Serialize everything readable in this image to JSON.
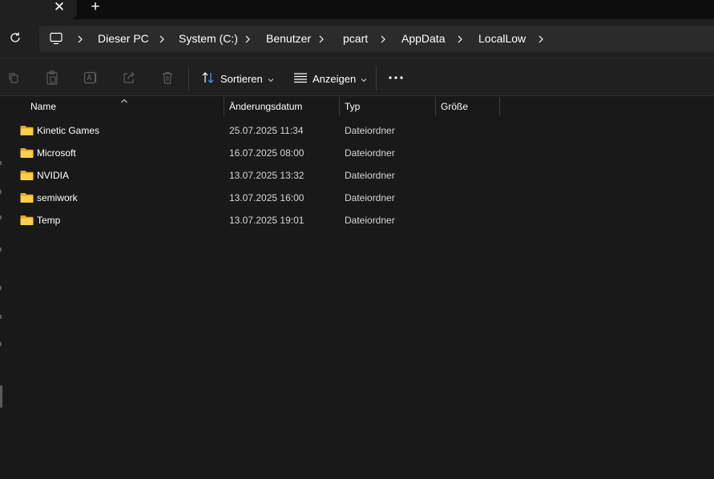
{
  "tabstrip": {
    "close_glyph": "✕",
    "new_tab_glyph": "+"
  },
  "address": {
    "refresh_icon": "refresh-icon",
    "computer_icon": "computer-icon",
    "separator_icon": "chevron-right-icon",
    "crumbs": [
      "Dieser PC",
      "System (C:)",
      "Benutzer",
      "pcart",
      "AppData",
      "LocalLow"
    ]
  },
  "commandbar": {
    "icons": [
      "copy-icon",
      "paste-icon",
      "rename-icon",
      "share-icon",
      "delete-icon"
    ],
    "sort_label": "Sortieren",
    "view_label": "Anzeigen",
    "more_icon": "more-icon"
  },
  "columns": {
    "name": "Name",
    "date": "Änderungsdatum",
    "type": "Typ",
    "size": "Größe"
  },
  "files": [
    {
      "name": "Kinetic Games",
      "date": "25.07.2025 11:34",
      "type": "Dateiordner"
    },
    {
      "name": "Microsoft",
      "date": "16.07.2025 08:00",
      "type": "Dateiordner"
    },
    {
      "name": "NVIDIA",
      "date": "13.07.2025 13:32",
      "type": "Dateiordner"
    },
    {
      "name": "semiwork",
      "date": "13.07.2025 16:00",
      "type": "Dateiordner"
    },
    {
      "name": "Temp",
      "date": "13.07.2025 19:01",
      "type": "Dateiordner"
    }
  ],
  "colors": {
    "background": "#191919",
    "toolbar": "#202020",
    "folder": "#f4c542",
    "accent_sort": "#4ea1ff"
  }
}
